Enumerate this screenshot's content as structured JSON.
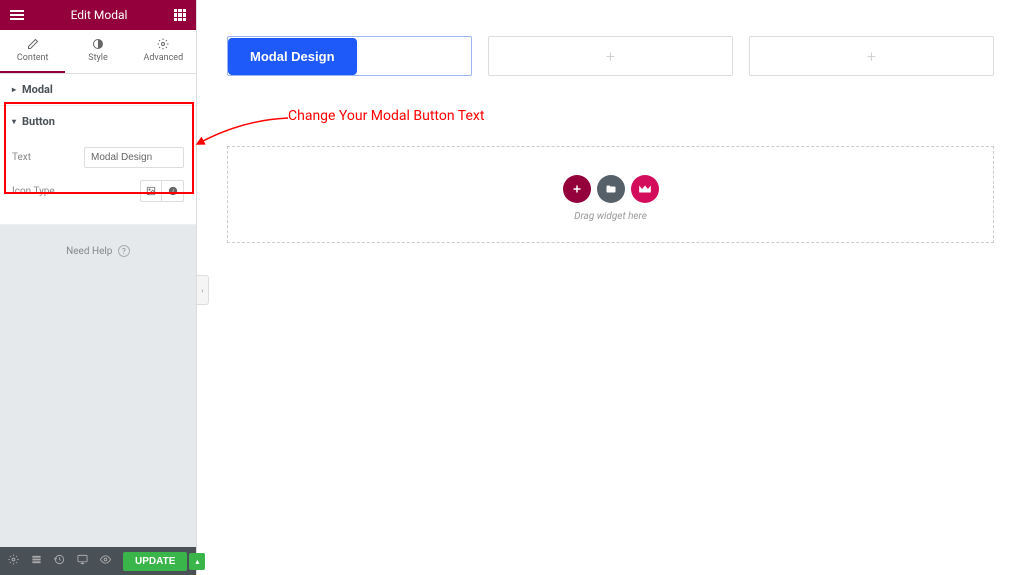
{
  "header": {
    "title": "Edit Modal"
  },
  "tabs": {
    "content": "Content",
    "style": "Style",
    "advanced": "Advanced"
  },
  "accordion": {
    "modal": "Modal",
    "button": "Button"
  },
  "fields": {
    "text_label": "Text",
    "text_value": "Modal Design",
    "icon_type_label": "Icon Type"
  },
  "help": "Need Help",
  "footer": {
    "update": "UPDATE"
  },
  "canvas": {
    "button_label": "Modal Design",
    "drop_text": "Drag widget here"
  },
  "annotation": "Change Your Modal Button Text"
}
